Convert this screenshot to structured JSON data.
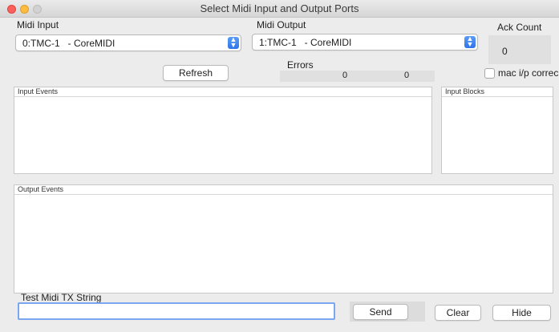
{
  "window": {
    "title": "Select Midi Input and Output Ports"
  },
  "midi_input": {
    "label": "Midi Input",
    "selected": "0:TMC-1   - CoreMIDI"
  },
  "midi_output": {
    "label": "Midi Output",
    "selected": "1:TMC-1   - CoreMIDI"
  },
  "ack": {
    "label": "Ack Count",
    "value": "0"
  },
  "refresh": {
    "label": "Refresh"
  },
  "errors": {
    "label": "Errors",
    "value1": "0",
    "value2": "0"
  },
  "mac_correct": {
    "label": "mac i/p correc",
    "checked": false
  },
  "panels": {
    "input_events": "Input Events",
    "input_blocks": "Input Blocks",
    "output_events": "Output Events"
  },
  "tx": {
    "label": "Test Midi TX String",
    "value": ""
  },
  "buttons": {
    "send": "Send",
    "clear": "Clear",
    "hide": "Hide"
  },
  "colors": {
    "accent": "#2f74ea",
    "focus_ring": "#7aa7f0"
  }
}
